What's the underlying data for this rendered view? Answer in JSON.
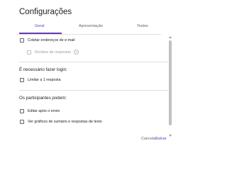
{
  "dialog": {
    "title": "Configurações",
    "tabs": [
      {
        "label": "Geral",
        "active": true
      },
      {
        "label": "Apresentação",
        "active": false
      },
      {
        "label": "Testes",
        "active": false
      }
    ],
    "general": {
      "collect_email": {
        "label": "Coletar endereços de e-mail",
        "checked": false
      },
      "response_receipts": {
        "label": "Recibos de respostas",
        "checked": false,
        "disabled": true,
        "help_icon": "help-icon"
      },
      "login_section": {
        "heading": "É necessário fazer login:",
        "limit_one": {
          "label": "Limitar a 1 resposta",
          "checked": false
        }
      },
      "participants_section": {
        "heading": "Os participantes podem:",
        "edit_after_submit": {
          "label": "Editar após o envio",
          "checked": false
        },
        "see_summary": {
          "label": "Ver gráficos de sumário e respostas de texto",
          "checked": false
        }
      }
    },
    "footer": {
      "cancel_label": "Cancelar",
      "save_label": "Salvar"
    }
  },
  "colors": {
    "accent": "#673ab7",
    "text": "#202124",
    "muted": "#5f6368",
    "divider": "#e0e0e0"
  }
}
